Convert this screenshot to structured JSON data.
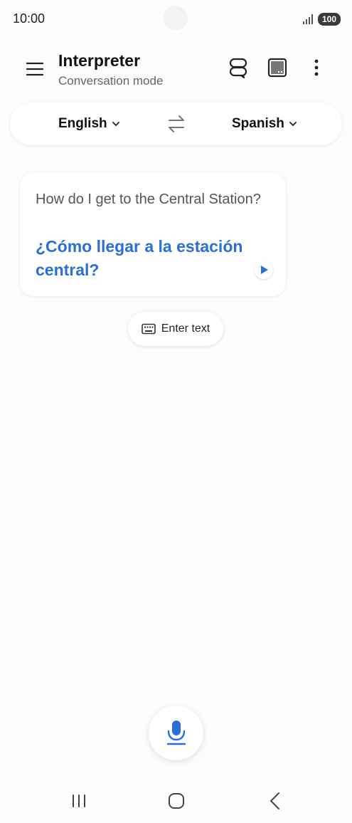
{
  "status_bar": {
    "time": "10:00",
    "battery": "100"
  },
  "header": {
    "title": "Interpreter",
    "subtitle": "Conversation mode"
  },
  "languages": {
    "source": "English",
    "target": "Spanish"
  },
  "card": {
    "source_text": "How do I get to the Central Station?",
    "translated_text": "¿Cómo llegar a la estación central?"
  },
  "enter_text": {
    "label": "Enter text"
  },
  "icons": {
    "menu": "hamburger-menu-icon",
    "conversation": "conversation-view-icon",
    "screen": "screen-view-icon",
    "more": "more-vertical-icon",
    "swap": "swap-arrows-icon",
    "keyboard": "keyboard-icon",
    "play": "play-icon",
    "mic": "microphone-icon"
  },
  "colors": {
    "accent": "#2a6fd6",
    "background": "#fcfcfe"
  }
}
